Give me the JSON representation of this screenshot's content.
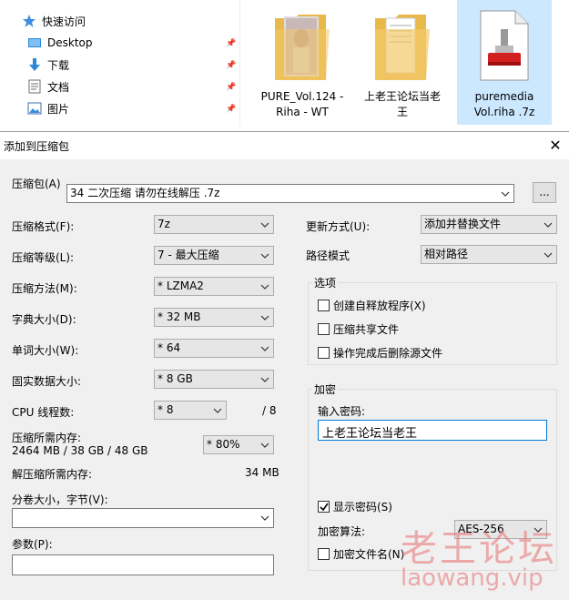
{
  "explorer": {
    "nav": {
      "quick_access": "快速访问",
      "items": [
        "Desktop",
        "下载",
        "文档",
        "图片"
      ]
    },
    "files": [
      {
        "line1": "PURE_Vol.124 -",
        "line2": "Riha - WT"
      },
      {
        "line1": "上老王论坛当老",
        "line2": "王"
      },
      {
        "line1": "puremedia",
        "line2": "Vol.riha .7z"
      }
    ]
  },
  "dialog": {
    "title": "添加到压缩包",
    "close": "✕",
    "archive": {
      "label": "压缩包(A)",
      "value": "34 二次压缩 请勿在线解压 .7z",
      "browse": "..."
    },
    "left": {
      "format": {
        "label": "压缩格式(F):",
        "value": "7z"
      },
      "level": {
        "label": "压缩等级(L):",
        "value": "7 - 最大压缩"
      },
      "method": {
        "label": "压缩方法(M):",
        "value": "*  LZMA2"
      },
      "dict": {
        "label": "字典大小(D):",
        "value": "*  32 MB"
      },
      "word": {
        "label": "单词大小(W):",
        "value": "*  64"
      },
      "solid": {
        "label": "固实数据大小:",
        "value": "*  8 GB"
      },
      "cpu": {
        "label": "CPU 线程数:",
        "value": "*  8",
        "max": "/ 8"
      },
      "mem": {
        "label": "压缩所需内存:",
        "detail": "2464 MB / 38 GB / 48 GB",
        "value": "* 80%"
      },
      "decomp": {
        "label": "解压缩所需内存:",
        "value": "34 MB"
      },
      "split": {
        "label": "分卷大小，字节(V):",
        "value": ""
      },
      "params": {
        "label": "参数(P):",
        "value": ""
      }
    },
    "right": {
      "update": {
        "label": "更新方式(U):",
        "value": "添加并替换文件"
      },
      "path": {
        "label": "路径模式",
        "value": "相对路径"
      },
      "options": {
        "title": "选项",
        "items": [
          "创建自释放程序(X)",
          "压缩共享文件",
          "操作完成后删除源文件"
        ]
      },
      "encrypt": {
        "title": "加密",
        "pwd_label": "输入密码:",
        "pwd_value": "上老王论坛当老王",
        "show_pwd": "显示密码(S)",
        "alg_label": "加密算法:",
        "alg_value": "AES-256",
        "enc_names": "加密文件名(N)"
      }
    }
  },
  "watermark": {
    "cn": "老王论坛",
    "en": "laowang.vip"
  }
}
